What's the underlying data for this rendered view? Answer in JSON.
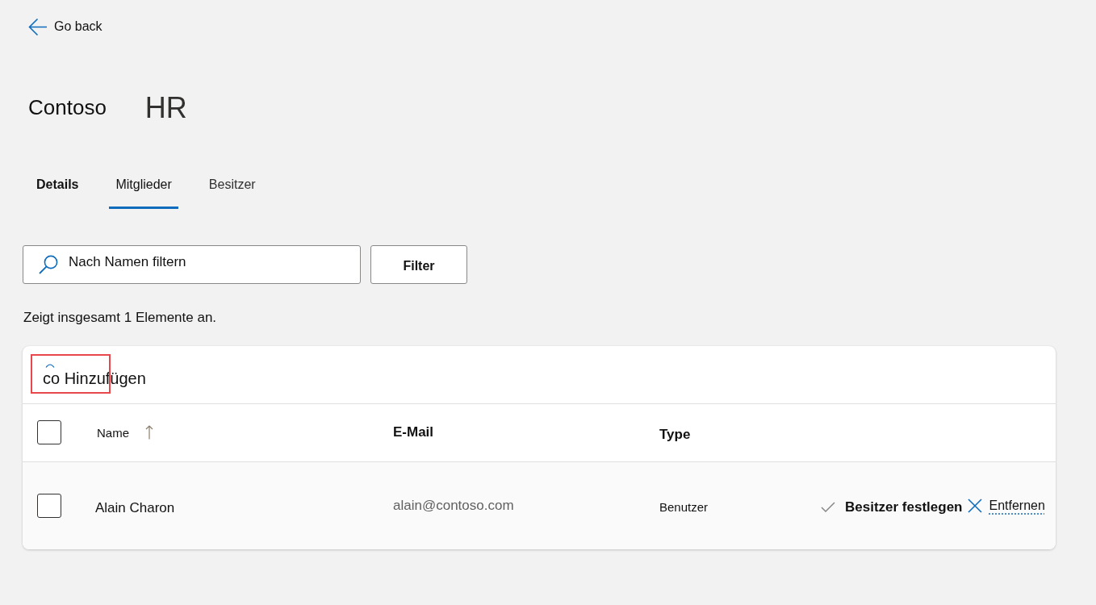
{
  "back_link": {
    "label": "Go back"
  },
  "title": {
    "org": "Contoso",
    "group": "HR"
  },
  "tabs": [
    {
      "label": "Details",
      "selected": false
    },
    {
      "label": "Mitglieder",
      "selected": true
    },
    {
      "label": "Besitzer",
      "selected": false
    }
  ],
  "search": {
    "placeholder": "Nach Namen filtern"
  },
  "filter_button": {
    "label": "Filter"
  },
  "summary": "Zeigt insgesamt 1 Elemente an.",
  "add_button": {
    "label": "co Hinzufügen",
    "highlighted": true
  },
  "table": {
    "select_all_checked": false,
    "columns": [
      {
        "label": "Name",
        "sorted": true
      },
      {
        "label": "E-Mail",
        "sorted": false
      },
      {
        "label": "Type",
        "sorted": false
      }
    ],
    "rows": [
      {
        "checked": false,
        "name": "Alain Charon",
        "email": "alain@contoso.com",
        "type": "Benutzer",
        "actions": [
          {
            "kind": "set_owner",
            "label": "Besitzer festlegen"
          },
          {
            "kind": "remove",
            "label": "Entfernen"
          }
        ]
      }
    ]
  }
}
